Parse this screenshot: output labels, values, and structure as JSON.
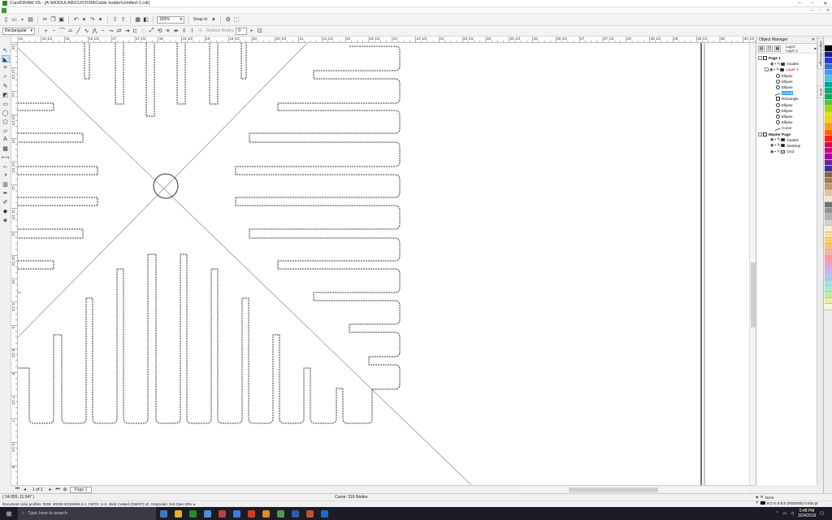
{
  "window": {
    "title": "CorelDRAW X5 - [A:\\MODULAR\\CUSTOM\\Cable holder\\Untitled-1.cdr]",
    "controls": [
      "–",
      "▫",
      "✕"
    ]
  },
  "toolbar": {
    "zoom_value": "150%",
    "snap_label": "Snap to",
    "object_type": "Rectangular",
    "reduce_nodes_label": "Reduce Nodes",
    "reduce_nodes_value": "0"
  },
  "hruler": {
    "labels": [
      "15",
      "15 1/2",
      "16",
      "16 1/2",
      "17",
      "17 1/2",
      "18",
      "18 1/2",
      "19",
      "19 1/2",
      "20",
      "20 1/2",
      "21",
      "21 1/2",
      "22",
      "22 1/2",
      "23",
      "23 1/2",
      "24",
      "24 1/2",
      "25",
      "25 1/2",
      "26",
      "26 1/2",
      "27",
      "27 1/2",
      "28",
      "28 1/2",
      "29",
      "29 1/2",
      "30",
      "30 1/2"
    ]
  },
  "vruler": {
    "labels": [
      "15",
      "14 1/2",
      "14",
      "13 1/2",
      "13",
      "12 1/2",
      "12",
      "11 1/2",
      "11",
      "10 1/2",
      "10",
      "9 1/2",
      "9",
      "8 1/2",
      "8",
      "7 1/2",
      "7",
      "6 1/2",
      "6"
    ]
  },
  "object_manager": {
    "title": "Object Manager",
    "layer_label": "Layer:",
    "layer_name": "Layer 1",
    "tree": [
      {
        "label": "Page 1",
        "level": 0,
        "kind": "page",
        "expander": "-",
        "bold": true
      },
      {
        "label": "Guides",
        "level": 1,
        "kind": "layer",
        "swatch": "#1a1aa0",
        "expander": ""
      },
      {
        "label": "Layer 1",
        "level": 1,
        "kind": "layer",
        "swatch": "#111111",
        "expander": "-",
        "red": true
      },
      {
        "label": "Ellipse",
        "level": 2,
        "kind": "ellipse"
      },
      {
        "label": "Ellipse",
        "level": 2,
        "kind": "ellipse"
      },
      {
        "label": "Ellipse",
        "level": 2,
        "kind": "ellipse"
      },
      {
        "label": "Curve",
        "level": 2,
        "kind": "curve",
        "selected": true
      },
      {
        "label": "Rectangle",
        "level": 2,
        "kind": "rect"
      },
      {
        "label": "Ellipse",
        "level": 2,
        "kind": "ellipse"
      },
      {
        "label": "Ellipse",
        "level": 2,
        "kind": "ellipse"
      },
      {
        "label": "Ellipse",
        "level": 2,
        "kind": "ellipse"
      },
      {
        "label": "Ellipse",
        "level": 2,
        "kind": "ellipse"
      },
      {
        "label": "Curve",
        "level": 2,
        "kind": "curve"
      },
      {
        "label": "Master Page",
        "level": 0,
        "kind": "page",
        "expander": "-",
        "bold": true
      },
      {
        "label": "Guides",
        "level": 1,
        "kind": "layer",
        "swatch": "#1a1aa0",
        "expander": ""
      },
      {
        "label": "Desktop",
        "level": 1,
        "kind": "layer",
        "swatch": "#111111",
        "expander": ""
      },
      {
        "label": "Grid",
        "level": 1,
        "kind": "layer",
        "swatch": "#dddddd",
        "expander": ""
      }
    ]
  },
  "docker_tabs": [
    "Object Manager",
    "Hints"
  ],
  "pagebar": {
    "page_count": "1 of 1",
    "tab_label": "Page 1"
  },
  "status": {
    "coords": "( 24.055, 11.947 )",
    "curve_info": "Curve: 316 Nodes",
    "color_profiles": "Document color profiles: RGB: sRGB IEC61966-2.1; CMYK: U.S. Web Coated (SWOP) v2; Grayscale: Dot Gain 20%",
    "fill_label": "None",
    "outline_label": "R:0 G:0 B:0 (#000000)  0.500 pt"
  },
  "taskbar": {
    "search_placeholder": "Type here to search",
    "time": "5:48 PM",
    "date": "3/24/2019",
    "app_icons": [
      "#3a78c8",
      "#e8b020",
      "#2a8a2a",
      "#4a90e0",
      "#c04040",
      "#3e7de0",
      "#d04020",
      "#e08a20",
      "#4a9a4a",
      "#2a5db0",
      "#c85030",
      "#1a6ad0"
    ]
  },
  "palette": [
    "#ffffff",
    "#000000",
    "#1a1a90",
    "#1f3ec0",
    "#2a6fd8",
    "#3b9de8",
    "#48c0f0",
    "#00a0a0",
    "#00b07a",
    "#00b050",
    "#60c030",
    "#a0d020",
    "#e0e020",
    "#ffd000",
    "#ffa000",
    "#ff6000",
    "#ff2000",
    "#e0004a",
    "#d0008a",
    "#a000a0",
    "#7020a0",
    "#4030a0",
    "#8a6040",
    "#a07a50",
    "#c09a70",
    "#e0c8a0",
    "#f0e6c8",
    "#707070",
    "#909090",
    "#b0b0b0",
    "#d0d0d0",
    "#fff0c0",
    "#ffe090",
    "#ffd070",
    "#ffc080",
    "#ffb0b0",
    "#ff9a9a",
    "#f0a0d0",
    "#d0b0f0",
    "#b0c8f0",
    "#a0e0f0",
    "#a0f0d0",
    "#c0f0a0",
    "#e8f0a0",
    "#f8f8d0"
  ],
  "drawing": {
    "outline_color": "#444444",
    "dotted_color": "#b07020",
    "guide_color": "#7a7a7a"
  }
}
